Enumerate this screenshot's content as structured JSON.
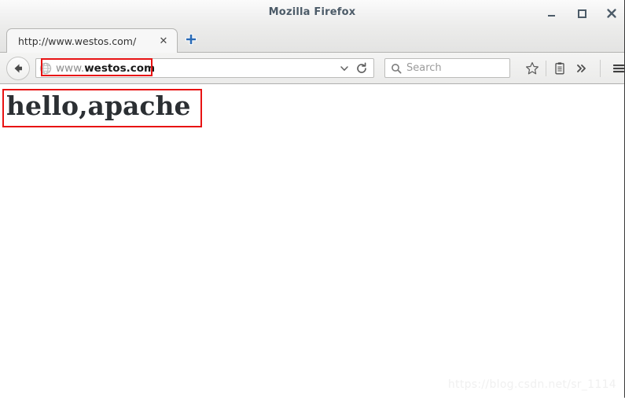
{
  "window": {
    "title": "Mozilla Firefox",
    "controls": [
      {
        "name": "minimize",
        "label": "_"
      },
      {
        "name": "maximize",
        "label": "□"
      },
      {
        "name": "close",
        "label": "✕"
      }
    ]
  },
  "tabbar": {
    "tabs": [
      {
        "title": "http://www.westos.com/",
        "close_label": "✕"
      }
    ],
    "new_tab_label": "+"
  },
  "toolbar": {
    "back_icon": "back-arrow-icon",
    "favicon": "globe-icon",
    "url": {
      "prefix": "www.",
      "domain": "westos.com",
      "full": "www.westos.com"
    },
    "dropdown_icon": "chevron-down-icon",
    "reload_icon": "reload-icon",
    "search": {
      "placeholder": "Search",
      "icon": "search-icon"
    },
    "icons": [
      {
        "name": "bookmark-star-icon"
      },
      {
        "name": "library-clipboard-icon"
      },
      {
        "name": "overflow-chevrons-icon"
      },
      {
        "name": "hamburger-menu-icon"
      }
    ]
  },
  "page": {
    "heading": "hello,apache",
    "watermark": "https://blog.csdn.net/sr_1114"
  },
  "colors": {
    "annotation_red": "#e81313",
    "titlebar_text": "#4c5b68",
    "accent_blue": "#2a6ab5"
  }
}
